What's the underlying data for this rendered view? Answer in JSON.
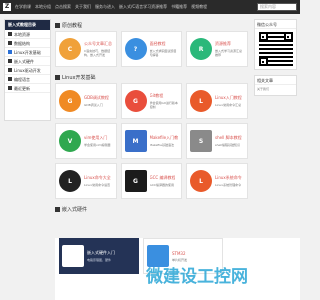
{
  "topnav": {
    "logo": "Z",
    "links": [
      "在学前课",
      "本地分组",
      "点击搜索",
      "关于我们",
      "服务与进入",
      "嵌入式/C语言学习资源推荐",
      "书籍推荐",
      "视频教程"
    ],
    "search_placeholder": "搜索内容"
  },
  "sidebar": {
    "header": "嵌入式教程目录",
    "items": [
      {
        "label": "本地资源"
      },
      {
        "label": "数据结构"
      },
      {
        "label": "Linux开发基础"
      },
      {
        "label": "嵌入式硬件"
      },
      {
        "label": "Linux驱动开发"
      },
      {
        "label": "编程语言"
      },
      {
        "label": "最近更新"
      }
    ]
  },
  "sections": [
    {
      "title": "原创教程",
      "cards": [
        {
          "title": "公众号文章汇总",
          "desc": "C语言技巧，数据结构，嵌入式开发",
          "color": "#f0a13a",
          "glyph": "C"
        },
        {
          "title": "面经教程",
          "desc": "嵌入式求职面试题目与解答",
          "color": "#3a8fe0",
          "glyph": "?"
        },
        {
          "title": "资源推荐",
          "desc": "嵌入式学习资源汇总推荐",
          "color": "#2ab87a",
          "glyph": "R"
        }
      ]
    },
    {
      "title": "Linux开发基础",
      "cards": [
        {
          "title": "GDB调试教程",
          "desc": "GDB调试入门",
          "color": "#f08a24",
          "glyph": "G"
        },
        {
          "title": "Git教程",
          "desc": "学会使用Git进行版本控制",
          "color": "#e94e3c",
          "glyph": "G"
        },
        {
          "title": "Linux入门教程",
          "desc": "Linux常用命令汇总",
          "color": "#e95a2a",
          "glyph": "L"
        },
        {
          "title": "vim使用入门",
          "desc": "学会使用vim编辑器",
          "color": "#2fa84f",
          "glyph": "V"
        },
        {
          "title": "Makefile入门教程",
          "desc": "Makefile基础语法",
          "color": "#3a6fc9",
          "glyph": "M"
        },
        {
          "title": "shell 脚本教程",
          "desc": "shell编程基础知识",
          "color": "#8a8a8a",
          "glyph": "S"
        },
        {
          "title": "Linux命令大全",
          "desc": "Linux常用命令速查",
          "color": "#222222",
          "glyph": "L"
        },
        {
          "title": "GCC 编译教程",
          "desc": "GCC编译器的使用",
          "color": "#1b1b1b",
          "glyph": "G"
        },
        {
          "title": "Linux系统命令",
          "desc": "Linux系统管理命令",
          "color": "#e95a2a",
          "glyph": "L"
        }
      ]
    },
    {
      "title": "嵌入式硬件",
      "cards": [
        {
          "title": "嵌入式硬件入门",
          "desc": "电路原理图，硬件",
          "color": "#ffffff",
          "glyph": ""
        },
        {
          "title": "STM32",
          "desc": "单片机开发",
          "color": "#3a8fe0",
          "glyph": ""
        }
      ]
    }
  ],
  "right": {
    "qr_title": "微信公众号",
    "about_title": "相关文章",
    "about_text": "关于我们"
  },
  "watermark": "微建设工控网"
}
